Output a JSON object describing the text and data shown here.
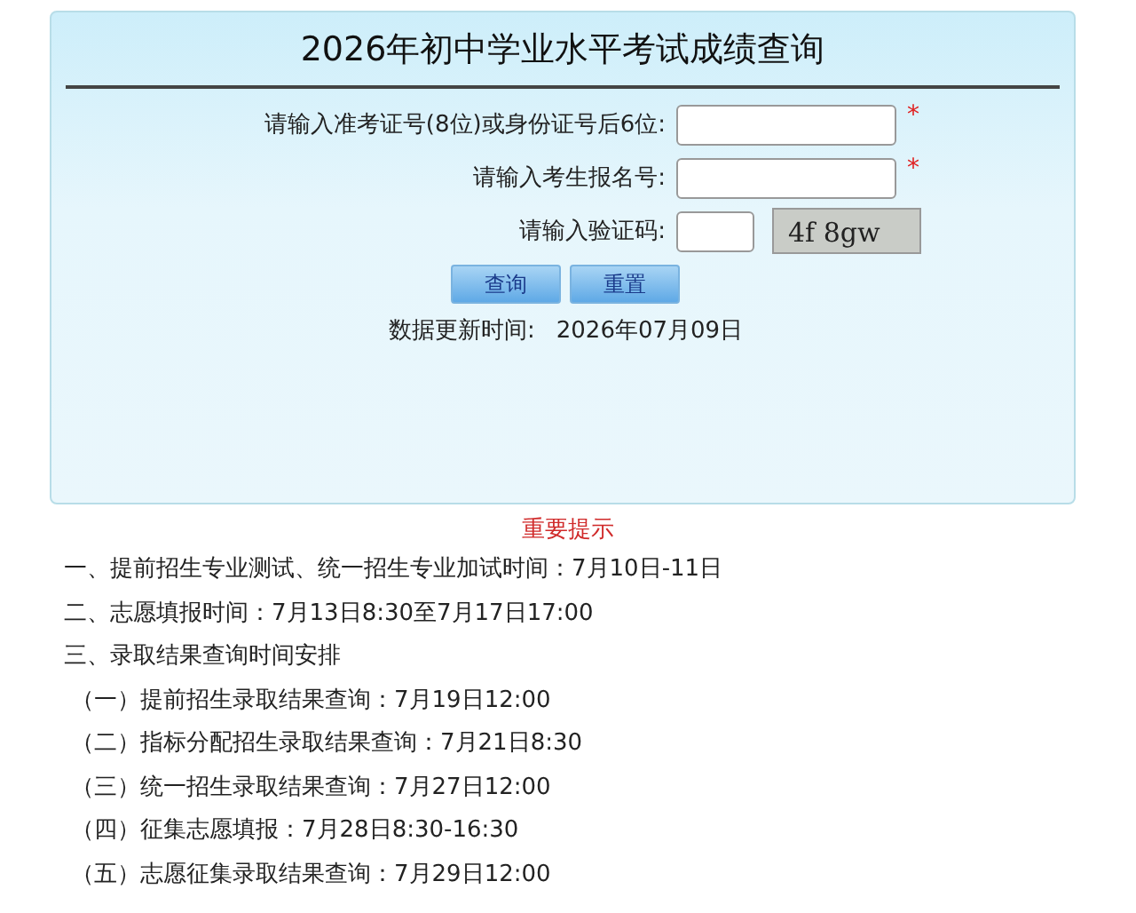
{
  "title": "2026年初中学业水平考试成绩查询",
  "fields": [
    {
      "label": "请输入准考证号(8位)或身份证号后6位:",
      "kind": "text",
      "required_mark": "*"
    },
    {
      "label": "请输入考生报名号:",
      "kind": "text",
      "required_mark": "*"
    },
    {
      "label": "请输入验证码:",
      "kind": "captcha",
      "captcha": "4f 8gw"
    }
  ],
  "buttons": [
    "查询",
    "重置"
  ],
  "update": {
    "label": "数据更新时间:",
    "value": "2026年07月09日"
  },
  "notice": {
    "heading": "重要提示",
    "items": [
      {
        "text": "一、提前招生专业测试、统一招生专业加试时间：7月10日-11日"
      },
      {
        "text": "二、志愿填报时间：7月13日8:30至7月17日17:00"
      },
      {
        "text": "三、录取结果查询时间安排",
        "children": [
          {
            "text": "（一）提前招生录取结果查询：7月19日12:00"
          },
          {
            "text": "（二）指标分配招生录取结果查询：7月21日8:30"
          },
          {
            "text": "（三）统一招生录取结果查询：7月27日12:00"
          },
          {
            "text": "（四）征集志愿填报：7月28日8:30-16:30"
          },
          {
            "text": "（五）志愿征集录取结果查询：7月29日12:00"
          }
        ]
      }
    ]
  }
}
